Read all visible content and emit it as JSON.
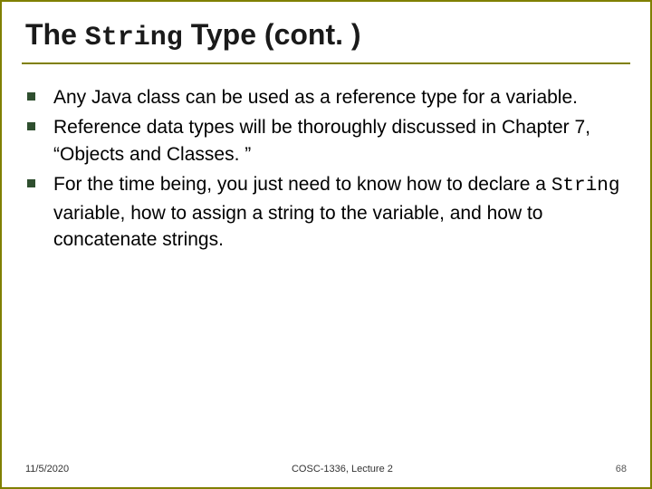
{
  "title": {
    "pre": "The ",
    "mono": "String",
    "post": " Type (cont. )"
  },
  "bullets": [
    "Any Java class can be used as a reference type for a variable.",
    "Reference data types will be thoroughly discussed in Chapter 7, “Objects and Classes. ”",
    {
      "pre": "For the time being, you just need to know how to declare a ",
      "mono": "String",
      "post": " variable, how to assign a string to the variable, and how to concatenate strings."
    }
  ],
  "footer": {
    "date": "11/5/2020",
    "course": "COSC-1336, Lecture 2",
    "page": "68"
  }
}
